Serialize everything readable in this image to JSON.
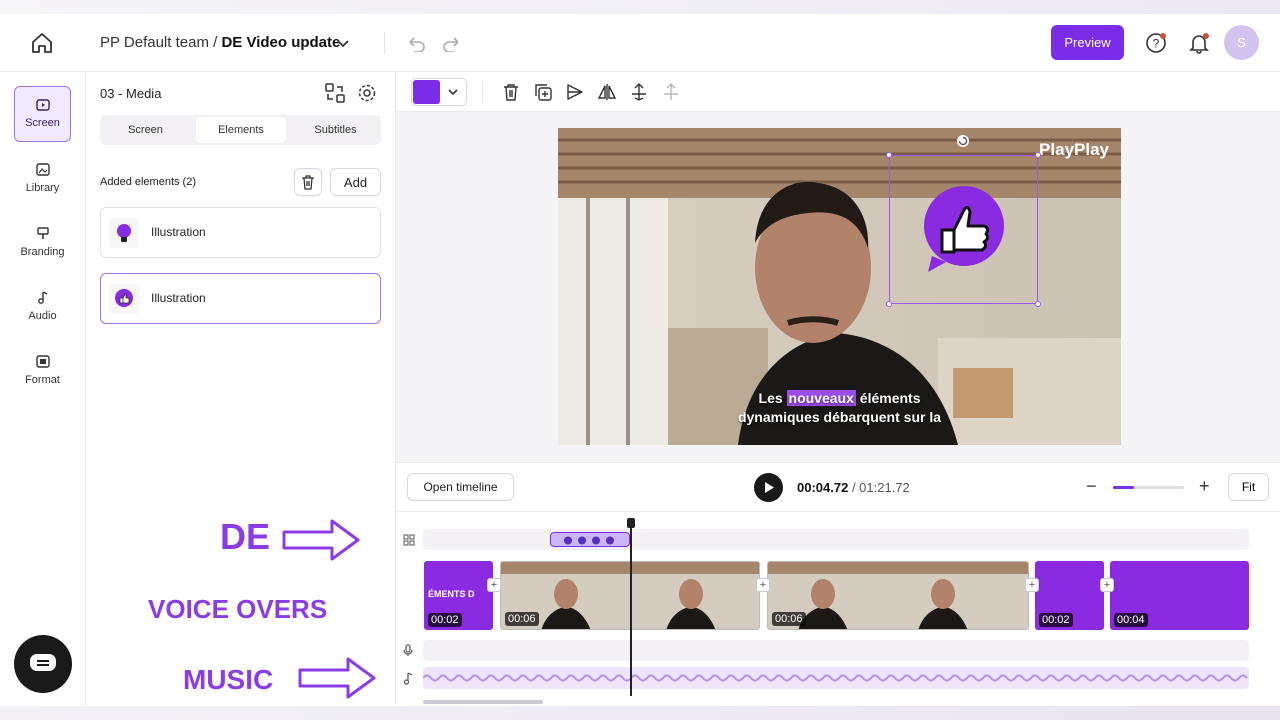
{
  "header": {
    "team": "PP Default team / ",
    "project": "DE Video update",
    "preview_label": "Preview",
    "avatar_initial": "S"
  },
  "nav": {
    "items": [
      {
        "label": "Screen",
        "icon": "screen-icon"
      },
      {
        "label": "Library",
        "icon": "library-icon"
      },
      {
        "label": "Branding",
        "icon": "branding-icon"
      },
      {
        "label": "Audio",
        "icon": "audio-icon"
      },
      {
        "label": "Format",
        "icon": "format-icon"
      }
    ]
  },
  "panel": {
    "title": "03 - Media",
    "tabs": [
      "Screen",
      "Elements",
      "Subtitles"
    ],
    "added_label": "Added elements (2)",
    "add_label": "Add",
    "elements": [
      {
        "label": "Illustration",
        "icon": "lightbulb-icon"
      },
      {
        "label": "Illustration",
        "icon": "thumbs-up-icon"
      }
    ]
  },
  "promo": {
    "de": "DE",
    "voice": "VOICE OVERS",
    "music": "MUSIC"
  },
  "video": {
    "brand": "PlayPlay",
    "caption_pre": "Les ",
    "caption_hl": "nouveaux",
    "caption_post": " éléments",
    "caption_line2": "dynamiques débarquent sur la"
  },
  "playback": {
    "open_timeline": "Open timeline",
    "current": "00:04.72",
    "total": " / 01:21.72",
    "fit_label": "Fit",
    "zoom_level": 0.3
  },
  "timeline": {
    "clips": [
      {
        "time": "00:02",
        "type": "text",
        "text": "ÉMENTS D"
      },
      {
        "time": "00:06",
        "type": "video"
      },
      {
        "time": "00:06",
        "type": "video"
      },
      {
        "time": "00:02",
        "type": "text"
      },
      {
        "time": "00:04",
        "type": "text"
      }
    ]
  },
  "colors": {
    "accent": "#7b2ce8",
    "clip_purple": "#8a2be2"
  }
}
